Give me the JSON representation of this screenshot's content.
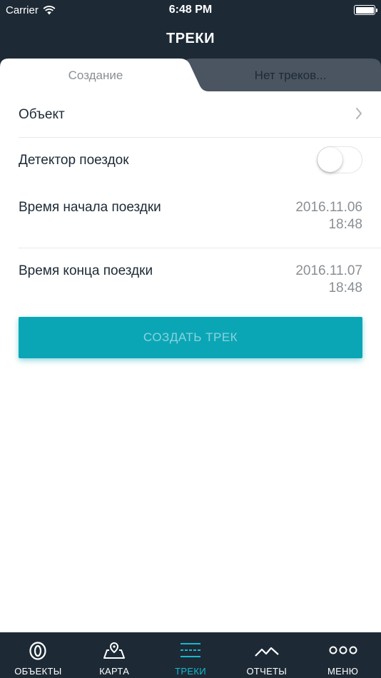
{
  "status_bar": {
    "carrier": "Carrier",
    "time": "6:48 PM"
  },
  "header": {
    "title": "ТРЕКИ"
  },
  "tabs": [
    {
      "label": "Создание",
      "active": true
    },
    {
      "label": "Нет треков...",
      "active": false
    }
  ],
  "form": {
    "object_label": "Объект",
    "trip_detector_label": "Детектор поездок",
    "trip_detector_on": false,
    "start_time_label": "Время начала поездки",
    "start_date": "2016.11.06",
    "start_time": "18:48",
    "end_time_label": "Время конца поездки",
    "end_date": "2016.11.07",
    "end_time": "18:48"
  },
  "create_button": "СОЗДАТЬ ТРЕК",
  "bottom_nav": [
    {
      "label": "ОБЪЕКТЫ",
      "icon": "objects-icon"
    },
    {
      "label": "КАРТА",
      "icon": "map-icon"
    },
    {
      "label": "ТРЕКИ",
      "icon": "tracks-icon",
      "active": true
    },
    {
      "label": "ОТЧЕТЫ",
      "icon": "reports-icon"
    },
    {
      "label": "МЕНЮ",
      "icon": "menu-icon"
    }
  ],
  "colors": {
    "header_bg": "#1d2a36",
    "accent": "#0ba6b6",
    "active_nav": "#16b8cb",
    "inactive_tab": "#4a5561"
  }
}
